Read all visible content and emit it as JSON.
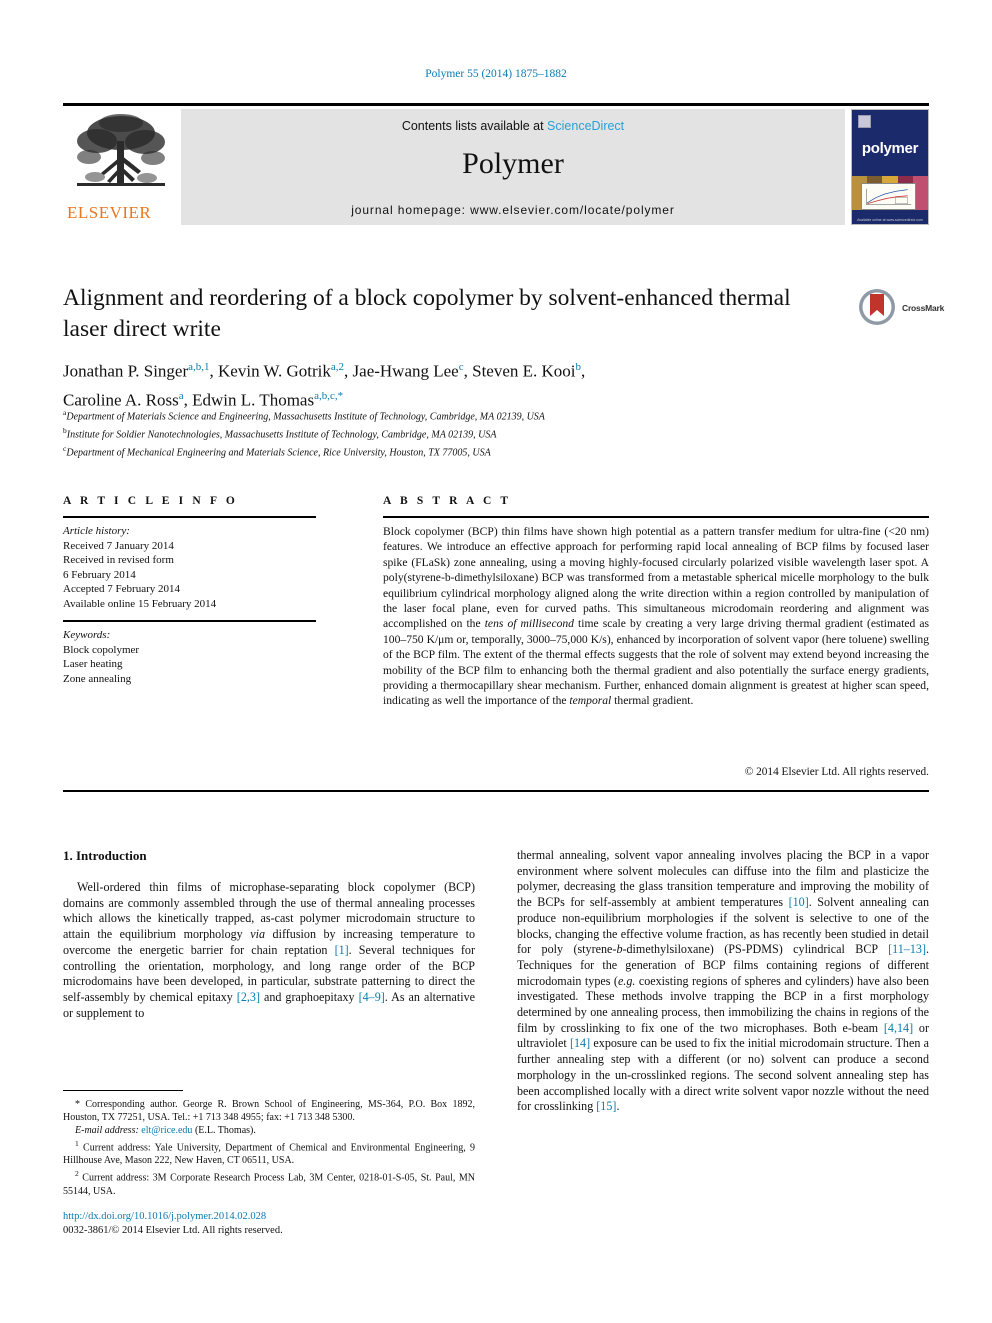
{
  "running_head": "Polymer 55 (2014) 1875–1882",
  "banner": {
    "publisher": "ELSEVIER",
    "contents_prefix": "Contents lists available at ",
    "contents_link": "ScienceDirect",
    "journal_name": "Polymer",
    "homepage": "journal homepage: www.elsevier.com/locate/polymer",
    "cover_title": "polymer",
    "cover_footer": "Available online at www.sciencedirect.com"
  },
  "article": {
    "title": "Alignment and reordering of a block copolymer by solvent-enhanced thermal laser direct write",
    "crossmark_label": "CrossMark",
    "authors": [
      {
        "name": "Jonathan P. Singer",
        "marks": "a,b,1"
      },
      {
        "name": "Kevin W. Gotrik",
        "marks": "a,2"
      },
      {
        "name": "Jae-Hwang Lee",
        "marks": "c"
      },
      {
        "name": "Steven E. Kooi",
        "marks": "b"
      },
      {
        "name": "Caroline A. Ross",
        "marks": "a"
      },
      {
        "name": "Edwin L. Thomas",
        "marks": "a,b,c,*"
      }
    ],
    "affiliations": [
      {
        "mark": "a",
        "text": "Department of Materials Science and Engineering, Massachusetts Institute of Technology, Cambridge, MA 02139, USA"
      },
      {
        "mark": "b",
        "text": "Institute for Soldier Nanotechnologies, Massachusetts Institute of Technology, Cambridge, MA 02139, USA"
      },
      {
        "mark": "c",
        "text": "Department of Mechanical Engineering and Materials Science, Rice University, Houston, TX 77005, USA"
      }
    ]
  },
  "article_info": {
    "heading": "A R T I C L E   I N F O",
    "history_label": "Article history:",
    "history": [
      "Received 7 January 2014",
      "Received in revised form",
      "6 February 2014",
      "Accepted 7 February 2014",
      "Available online 15 February 2014"
    ],
    "keywords_label": "Keywords:",
    "keywords": [
      "Block copolymer",
      "Laser heating",
      "Zone annealing"
    ]
  },
  "abstract": {
    "heading": "A B S T R A C T",
    "text_part1": "Block copolymer (BCP) thin films have shown high potential as a pattern transfer medium for ultra-fine (<20 nm) features. We introduce an effective approach for performing rapid local annealing of BCP films by focused laser spike (FLaSk) zone annealing, using a moving highly-focused circularly polarized visible wavelength laser spot. A poly(styrene-b-dimethylsiloxane) BCP was transformed from a metastable spherical micelle morphology to the bulk equilibrium cylindrical morphology aligned along the write direction within a region controlled by manipulation of the laser focal plane, even for curved paths. This simultaneous microdomain reordering and alignment was accomplished on the ",
    "italic1": "tens of millisecond",
    "text_part2": " time scale by creating a very large driving thermal gradient (estimated as 100–750 K/μm or, temporally, 3000–75,000 K/s), enhanced by incorporation of solvent vapor (here toluene) swelling of the BCP film. The extent of the thermal effects suggests that the role of solvent may extend beyond increasing the mobility of the BCP film to enhancing both the thermal gradient and also potentially the surface energy gradients, providing a thermocapillary shear mechanism. Further, enhanced domain alignment is greatest at higher scan speed, indicating as well the importance of the ",
    "italic2": "temporal",
    "text_part3": " thermal gradient.",
    "copyright": "© 2014 Elsevier Ltd. All rights reserved."
  },
  "body": {
    "section_number_title": "1. Introduction",
    "left_col_part1": "Well-ordered thin films of microphase-separating block copolymer (BCP) domains are commonly assembled through the use of thermal annealing processes which allows the kinetically trapped, as-cast polymer microdomain structure to attain the equilibrium morphology ",
    "left_italic1": "via",
    "left_col_part2": " diffusion by increasing temperature to overcome the energetic barrier for chain reptation ",
    "left_ref1": "[1]",
    "left_col_part3": ". Several techniques for controlling the orientation, morphology, and long range order of the BCP microdomains have been developed, in particular, substrate patterning to direct the self-assembly by chemical epitaxy ",
    "left_ref2": "[2,3]",
    "left_col_part4": " and graphoepitaxy ",
    "left_ref3": "[4–9]",
    "left_col_part5": ". As an alternative or supplement to",
    "right_col_part1": "thermal annealing, solvent vapor annealing involves placing the BCP in a vapor environment where solvent molecules can diffuse into the film and plasticize the polymer, decreasing the glass transition temperature and improving the mobility of the BCPs for self-assembly at ambient temperatures ",
    "right_ref1": "[10]",
    "right_col_part2": ". Solvent annealing can produce non-equilibrium morphologies if the solvent is selective to one of the blocks, changing the effective volume fraction, as has recently been studied in detail for poly (styrene-",
    "right_italic1": "b",
    "right_col_part3": "-dimethylsiloxane) (PS-PDMS) cylindrical BCP ",
    "right_ref2": "[11–13]",
    "right_col_part4": ". Techniques for the generation of BCP films containing regions of different microdomain types (",
    "right_italic2": "e.g.",
    "right_col_part5": " coexisting regions of spheres and cylinders) have also been investigated. These methods involve trapping the BCP in a first morphology determined by one annealing process, then immobilizing the chains in regions of the film by crosslinking to fix one of the two microphases. Both e-beam ",
    "right_ref3": "[4,14]",
    "right_col_part6": " or ultraviolet ",
    "right_ref4": "[14]",
    "right_col_part7": " exposure can be used to fix the initial microdomain structure. Then a further annealing step with a different (or no) solvent can produce a second morphology in the un-crosslinked regions. The second solvent annealing step has been accomplished locally with a direct write solvent vapor nozzle without the need for crosslinking ",
    "right_ref5": "[15]",
    "right_col_part8": "."
  },
  "footnotes": {
    "corresponding_mark": "*",
    "corresponding": " Corresponding author. George R. Brown School of Engineering, MS-364, P.O. Box 1892, Houston, TX 77251, USA. Tel.: +1 713 348 4955; fax: +1 713 348 5300.",
    "email_label": "E-mail address:",
    "email": "elt@rice.edu",
    "email_person": " (E.L. Thomas).",
    "note1_mark": "1",
    "note1": " Current address: Yale University, Department of Chemical and Environmental Engineering, 9 Hillhouse Ave, Mason 222, New Haven, CT 06511, USA.",
    "note2_mark": "2",
    "note2": " Current address: 3M Corporate Research Process Lab, 3M Center, 0218-01-S-05, St. Paul, MN 55144, USA."
  },
  "footer": {
    "doi": "http://dx.doi.org/10.1016/j.polymer.2014.02.028",
    "issn": "0032-3861/© 2014 Elsevier Ltd. All rights reserved."
  },
  "colors": {
    "link": "#0a7ab0",
    "sciencedirect": "#2a9fd6",
    "elsevier_orange": "#e87722",
    "banner_bg": "#e3e3e3",
    "cover_blue": "#1b2a6b",
    "crossmark_red": "#c0342b"
  }
}
